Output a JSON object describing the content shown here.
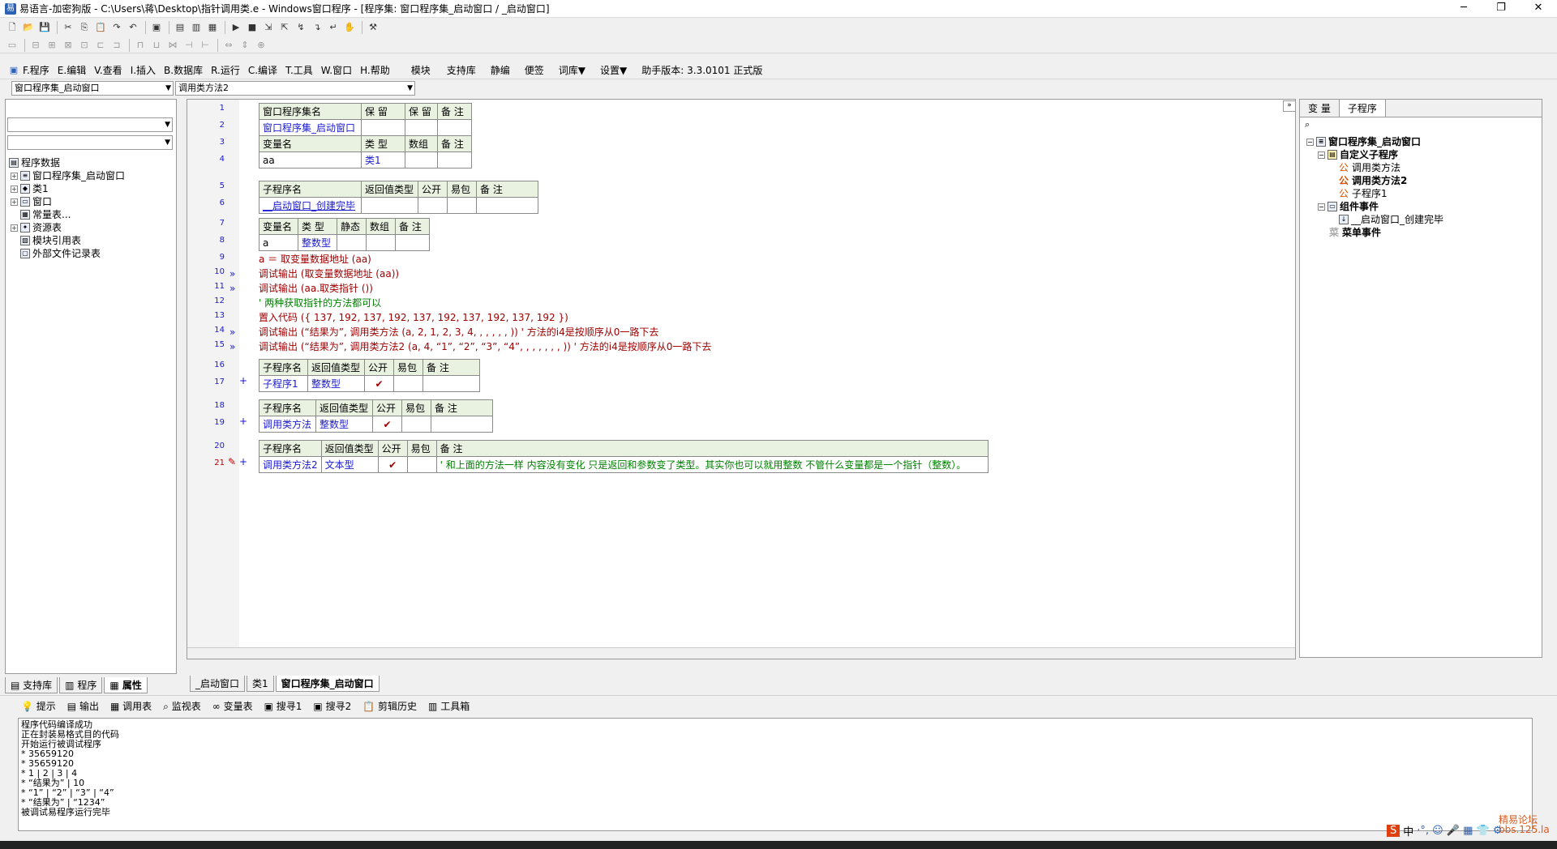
{
  "window": {
    "title": "易语言-加密狗版 - C:\\Users\\蒋\\Desktop\\指针调用类.e - Windows窗口程序 - [程序集: 窗口程序集_启动窗口 / _启动窗口]",
    "min": "─",
    "max": "❐",
    "close": "✕"
  },
  "menu": {
    "items": [
      "F.程序",
      "E.编辑",
      "V.查看",
      "I.插入",
      "B.数据库",
      "R.运行",
      "C.编译",
      "T.工具",
      "W.窗口",
      "H.帮助",
      "模块",
      "支持库",
      "静编",
      "便签",
      "词库▼",
      "设置▼",
      "助手版本: 3.3.0101 正式版"
    ]
  },
  "selectors": {
    "assembly": "窗口程序集_启动窗口",
    "method": "调用类方法2"
  },
  "left_tree": {
    "root": "程序数据",
    "items": [
      "窗口程序集_启动窗口",
      "类1",
      "窗口",
      "常量表...",
      "资源表",
      "模块引用表",
      "外部文件记录表"
    ]
  },
  "left_tabs": [
    "支持库",
    "程序",
    "属性"
  ],
  "code": {
    "line_numbers": [
      "1",
      "2",
      "3",
      "4",
      "5",
      "6",
      "7",
      "8",
      "9",
      "10",
      "11",
      "12",
      "13",
      "14",
      "15",
      "16",
      "17",
      "18",
      "19",
      "20",
      "21"
    ],
    "assembly_table": {
      "header": [
        "窗口程序集名",
        "保 留",
        "保 留",
        "备 注"
      ],
      "row": [
        "窗口程序集_启动窗口",
        "",
        "",
        ""
      ],
      "var_header": [
        "变量名",
        "类 型",
        "数组",
        "备 注"
      ],
      "var_row": [
        "aa",
        "类1",
        "",
        ""
      ]
    },
    "sub1": {
      "header": [
        "子程序名",
        "返回值类型",
        "公开",
        "易包",
        "备 注"
      ],
      "row": [
        "__启动窗口_创建完毕",
        "",
        "",
        "",
        ""
      ],
      "var_header": [
        "变量名",
        "类 型",
        "静态",
        "数组",
        "备 注"
      ],
      "var_row": [
        "a",
        "整数型",
        "",
        "",
        ""
      ]
    },
    "lines": {
      "l9": "a ＝ 取变量数据地址 (aa)",
      "l10": "调试输出 (取变量数据地址 (aa))",
      "l11": "调试输出 (aa.取类指针 ())",
      "l12": "' 两种获取指针的方法都可以",
      "l13": "置入代码 ({ 137, 192, 137, 192, 137, 192, 137, 192, 137, 192 })",
      "l14": "调试输出 (“结果为”, 调用类方法 (a, 2, 1, 2, 3, 4, , , , , , ))  ' 方法的i4是按顺序从0一路下去",
      "l15": "调试输出 (“结果为”, 调用类方法2 (a, 4, “1”, “2”, “3”, “4”, , , , , , , ))  ' 方法的i4是按顺序从0一路下去"
    },
    "sub2": {
      "header": [
        "子程序名",
        "返回值类型",
        "公开",
        "易包",
        "备 注"
      ],
      "row": [
        "子程序1",
        "整数型",
        "✔",
        "",
        ""
      ]
    },
    "sub3": {
      "header": [
        "子程序名",
        "返回值类型",
        "公开",
        "易包",
        "备 注"
      ],
      "row": [
        "调用类方法",
        "整数型",
        "✔",
        "",
        ""
      ]
    },
    "sub4": {
      "header": [
        "子程序名",
        "返回值类型",
        "公开",
        "易包",
        "备 注"
      ],
      "row": [
        "调用类方法2",
        "文本型",
        "✔",
        "",
        "' 和上面的方法一样 内容没有变化 只是返回和参数变了类型。其实你也可以就用整数 不管什么变量都是一个指针（整数）。"
      ]
    }
  },
  "editor_tabs": [
    "_启动窗口",
    "类1",
    "窗口程序集_启动窗口"
  ],
  "right_panel": {
    "tabs": [
      "变 量",
      "子程序"
    ],
    "tree": {
      "root": "窗口程序集_启动窗口",
      "custom": "自定义子程序",
      "subs": [
        "调用类方法",
        "调用类方法2",
        "子程序1"
      ],
      "events": "组件事件",
      "event_items": [
        "__启动窗口_创建完毕"
      ],
      "menu_events": "菜单事件"
    }
  },
  "output_tabs": [
    "提示",
    "输出",
    "调用表",
    "监视表",
    "变量表",
    "搜寻1",
    "搜寻2",
    "剪辑历史",
    "工具箱"
  ],
  "output_lines": [
    "程序代码编译成功",
    "正在封装易格式目的代码",
    "开始运行被调试程序",
    "* 35659120",
    "* 35659120",
    "* 1 | 2 | 3 | 4",
    "* “结果为” | 10",
    "* “1” | “2” | “3” | “4”",
    "* “结果为” | “1234”",
    "被调试易程序运行完毕"
  ],
  "watermark": {
    "line1": "精易论坛",
    "line2": "bbs.125.la"
  },
  "tray": {
    "ime": "中",
    "text": "·°, ☺ 🎤 ▦ 👕 ⚙"
  }
}
